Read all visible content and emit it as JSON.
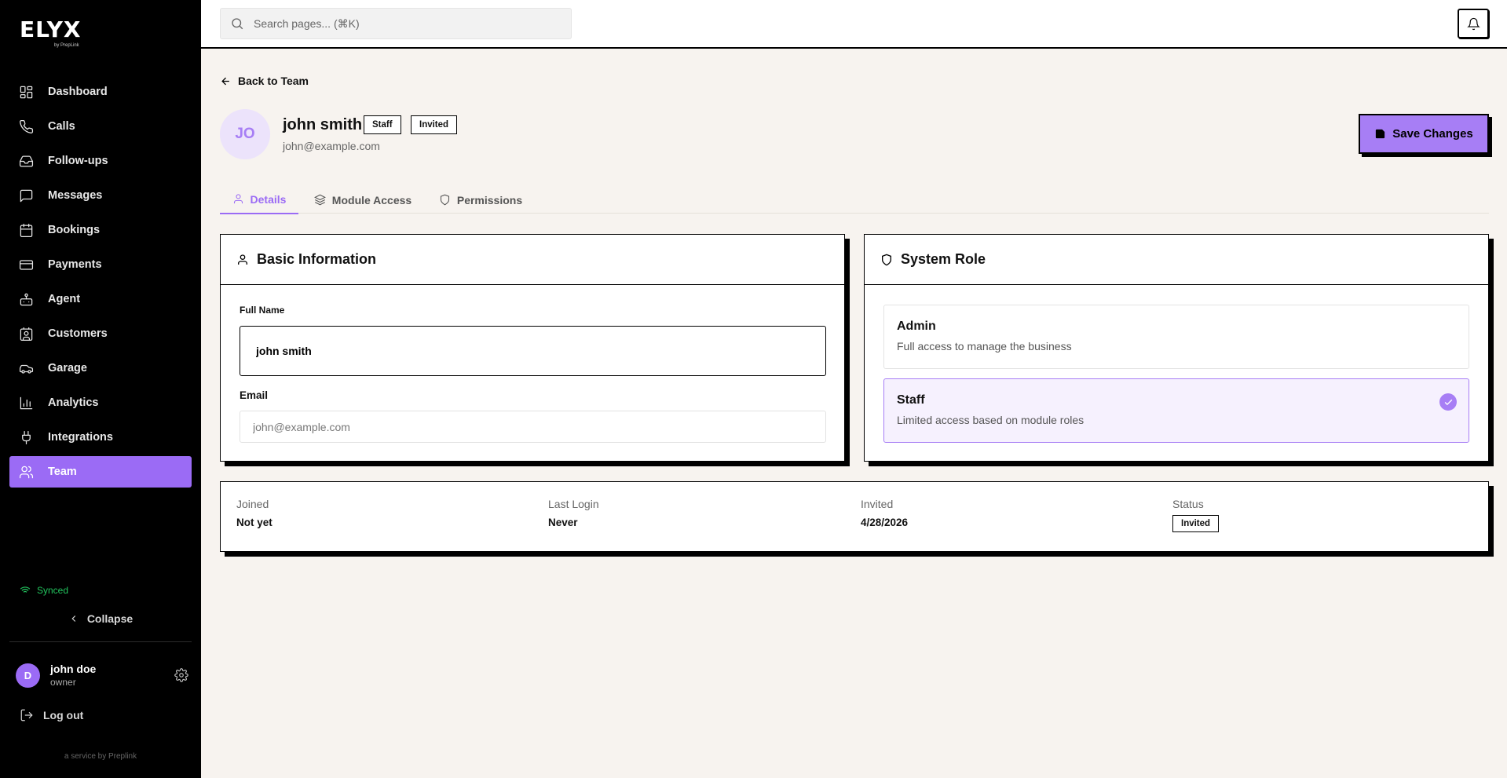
{
  "brand": {
    "name": "ELYX",
    "sub": "by PrepLink"
  },
  "sidebar": {
    "items": [
      {
        "label": "Dashboard",
        "icon": "dashboard-icon"
      },
      {
        "label": "Calls",
        "icon": "phone-icon"
      },
      {
        "label": "Follow-ups",
        "icon": "inbox-icon"
      },
      {
        "label": "Messages",
        "icon": "message-icon"
      },
      {
        "label": "Bookings",
        "icon": "calendar-icon"
      },
      {
        "label": "Payments",
        "icon": "credit-card-icon"
      },
      {
        "label": "Agent",
        "icon": "bot-icon"
      },
      {
        "label": "Customers",
        "icon": "contact-icon"
      },
      {
        "label": "Garage",
        "icon": "car-icon"
      },
      {
        "label": "Analytics",
        "icon": "bar-chart-icon"
      },
      {
        "label": "Integrations",
        "icon": "plug-icon"
      },
      {
        "label": "Team",
        "icon": "users-icon",
        "active": true
      }
    ],
    "synced": "Synced",
    "collapse": "Collapse",
    "user": {
      "initial": "D",
      "name": "john doe",
      "role": "owner"
    },
    "logout": "Log out",
    "service": "a service by Preplink"
  },
  "topbar": {
    "search_placeholder": "Search pages... (⌘K)"
  },
  "page": {
    "back": "Back to Team",
    "avatar_initials": "JO",
    "name": "john smith",
    "badges": [
      "Staff",
      "Invited"
    ],
    "email": "john@example.com",
    "save": "Save Changes",
    "tabs": [
      "Details",
      "Module Access",
      "Permissions"
    ],
    "active_tab": "Details"
  },
  "basic_info": {
    "title": "Basic Information",
    "full_name_label": "Full Name",
    "full_name_value": "john smith",
    "email_label": "Email",
    "email_value": "john@example.com"
  },
  "system_role": {
    "title": "System Role",
    "roles": [
      {
        "title": "Admin",
        "desc": "Full access to manage the business",
        "selected": false
      },
      {
        "title": "Staff",
        "desc": "Limited access based on module roles",
        "selected": true
      }
    ]
  },
  "stats": [
    {
      "label": "Joined",
      "value": "Not yet"
    },
    {
      "label": "Last Login",
      "value": "Never"
    },
    {
      "label": "Invited",
      "value": "4/28/2026"
    },
    {
      "label": "Status",
      "value": "Invited"
    }
  ],
  "colors": {
    "accent": "#9b6bf5",
    "accent_light": "#a77ef5",
    "background": "#f7f3ef",
    "sidebar": "#000000",
    "synced": "#22c55e"
  }
}
